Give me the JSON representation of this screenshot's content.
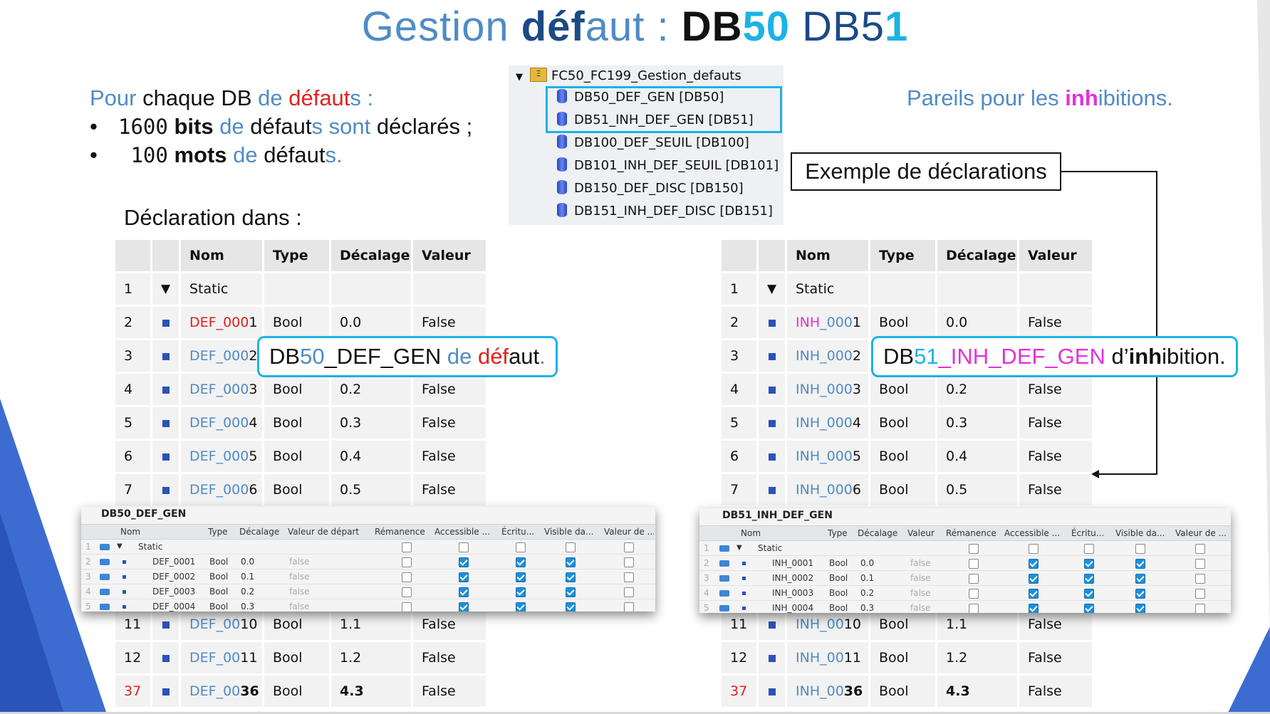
{
  "title": {
    "w1": "Gestion ",
    "w2a": "déf",
    "w2b": "aut",
    "w3": " : ",
    "w4a": "DB",
    "w4b": "50",
    "w5a": " DB5",
    "w5b": "1"
  },
  "intro": {
    "p1": "Pour ",
    "p2": "chaque DB ",
    "p3": "de ",
    "p4": "défaut",
    "p5": "s :"
  },
  "bullets": [
    {
      "dot": "•",
      "num": "1600",
      "a": " bits ",
      "b": "de ",
      "c": "défaut",
      "d": "s ",
      "e": "sont ",
      "f": "déclarés ;"
    },
    {
      "dot": "•",
      "num": " 100",
      "a": " mots ",
      "b": "de ",
      "c": "défaut",
      "d": "s."
    }
  ],
  "pareils": {
    "a": "Pareils pour les ",
    "b": "inh",
    "c": "ibition",
    "d": "s."
  },
  "declaration_label": "Déclaration dans :",
  "tree": {
    "root": "FC50_FC199_Gestion_defauts",
    "items": [
      "DB50_DEF_GEN [DB50]",
      "DB51_INH_DEF_GEN [DB51]",
      "DB100_DEF_SEUIL [DB100]",
      "DB101_INH_DEF_SEUIL [DB101]",
      "DB150_DEF_DISC [DB150]",
      "DB151_INH_DEF_DISC [DB151]"
    ]
  },
  "example_box": "Exemple de déclarations",
  "table_headers": {
    "nom": "Nom",
    "type": "Type",
    "decalage": "Décalage",
    "valeur": "Valeur"
  },
  "left_table": {
    "rows": [
      {
        "n": "1",
        "tri": "▼",
        "name": "Static",
        "type": "",
        "dec": "",
        "val": ""
      },
      {
        "n": "2",
        "na": "DEF_000",
        "nb": "1",
        "type": "Bool",
        "dec": "0.0",
        "val": "False"
      },
      {
        "n": "3",
        "na": "DEF_000",
        "nb": "2",
        "type": "",
        "dec": "",
        "val": ""
      },
      {
        "n": "4",
        "na": "DEF_000",
        "nb": "3",
        "type": "Bool",
        "dec": "0.2",
        "val": "False"
      },
      {
        "n": "5",
        "na": "DEF_000",
        "nb": "4",
        "type": "Bool",
        "dec": "0.3",
        "val": "False"
      },
      {
        "n": "6",
        "na": "DEF_000",
        "nb": "5",
        "type": "Bool",
        "dec": "0.4",
        "val": "False"
      },
      {
        "n": "7",
        "na": "DEF_000",
        "nb": "6",
        "type": "Bool",
        "dec": "0.5",
        "val": "False"
      },
      {
        "n": "11",
        "na": "DEF_00",
        "nb": "10",
        "type": "Bool",
        "dec": "1.1",
        "val": "False"
      },
      {
        "n": "12",
        "na": "DEF_00",
        "nb": "11",
        "type": "Bool",
        "dec": "1.2",
        "val": "False"
      },
      {
        "n": "37",
        "na": "DEF_00",
        "nb": "36",
        "type": "Bool",
        "dec": "4.3",
        "val": "False"
      }
    ]
  },
  "right_table": {
    "rows": [
      {
        "n": "1",
        "tri": "▼",
        "name": "Static",
        "type": "",
        "dec": "",
        "val": ""
      },
      {
        "n": "2",
        "na": "INH",
        "nc": "_000",
        "nb": "1",
        "type": "Bool",
        "dec": "0.0",
        "val": "False"
      },
      {
        "n": "3",
        "na": "INH_000",
        "nb": "2",
        "type": "",
        "dec": "",
        "val": ""
      },
      {
        "n": "4",
        "na": "INH_000",
        "nb": "3",
        "type": "Bool",
        "dec": "0.2",
        "val": "False"
      },
      {
        "n": "5",
        "na": "INH_000",
        "nb": "4",
        "type": "Bool",
        "dec": "0.3",
        "val": "False"
      },
      {
        "n": "6",
        "na": "INH_000",
        "nb": "5",
        "type": "Bool",
        "dec": "0.4",
        "val": "False"
      },
      {
        "n": "7",
        "na": "INH_000",
        "nb": "6",
        "type": "Bool",
        "dec": "0.5",
        "val": "False"
      },
      {
        "n": "11",
        "na": "INH_00",
        "nb": "10",
        "type": "Bool",
        "dec": "1.1",
        "val": "False"
      },
      {
        "n": "12",
        "na": "INH_00",
        "nb": "11",
        "type": "Bool",
        "dec": "1.2",
        "val": "False"
      },
      {
        "n": "37",
        "na": "INH_00",
        "nb": "36",
        "type": "Bool",
        "dec": "4.3",
        "val": "False"
      }
    ]
  },
  "callout_left": {
    "a": "DB",
    "b": "50",
    "c": "_DEF_GEN ",
    "d": "de ",
    "e": "déf",
    "f": "aut",
    "g": "."
  },
  "callout_right": {
    "a": "DB",
    "b": "51",
    "c": "_INH_DEF_GEN",
    "d": " d’",
    "e": "inh",
    "f": "ibition."
  },
  "shot_left": {
    "title": "DB50_DEF_GEN",
    "headers": [
      "Nom",
      "Type",
      "Décalage",
      "Valeur de départ",
      "Rémanence",
      "Accessible ...",
      "Écritu...",
      "Visible da...",
      "Valeur de ..."
    ],
    "static": "Static",
    "rows": [
      {
        "ln": "2",
        "name": "DEF_0001",
        "type": "Bool",
        "dec": "0.0",
        "start": "false"
      },
      {
        "ln": "3",
        "name": "DEF_0002",
        "type": "Bool",
        "dec": "0.1",
        "start": "false"
      },
      {
        "ln": "4",
        "name": "DEF_0003",
        "type": "Bool",
        "dec": "0.2",
        "start": "false"
      },
      {
        "ln": "5",
        "name": "DEF_0004",
        "type": "Bool",
        "dec": "0.3",
        "start": "false"
      }
    ]
  },
  "shot_right": {
    "title": "DB51_INH_DEF_GEN",
    "headers": [
      "Nom",
      "Type",
      "Décalage",
      "Valeur",
      "Rémanence",
      "Accessible ...",
      "Écritu...",
      "Visible da...",
      "Valeur de ..."
    ],
    "static": "Static",
    "rows": [
      {
        "ln": "2",
        "name": "INH_0001",
        "type": "Bool",
        "dec": "0.0",
        "start": "false"
      },
      {
        "ln": "3",
        "name": "INH_0002",
        "type": "Bool",
        "dec": "0.1",
        "start": "false"
      },
      {
        "ln": "4",
        "name": "INH_0003",
        "type": "Bool",
        "dec": "0.2",
        "start": "false"
      },
      {
        "ln": "5",
        "name": "INH_0004",
        "type": "Bool",
        "dec": "0.3",
        "start": "false"
      }
    ]
  },
  "colors": {
    "title_light": "#4f8bc6",
    "title_dark": "#1c4a86",
    "accent_cyan": "#1cb2e6",
    "red": "#e0211f",
    "magenta": "#e232d9",
    "corner_blue": "#3d6cd0"
  }
}
